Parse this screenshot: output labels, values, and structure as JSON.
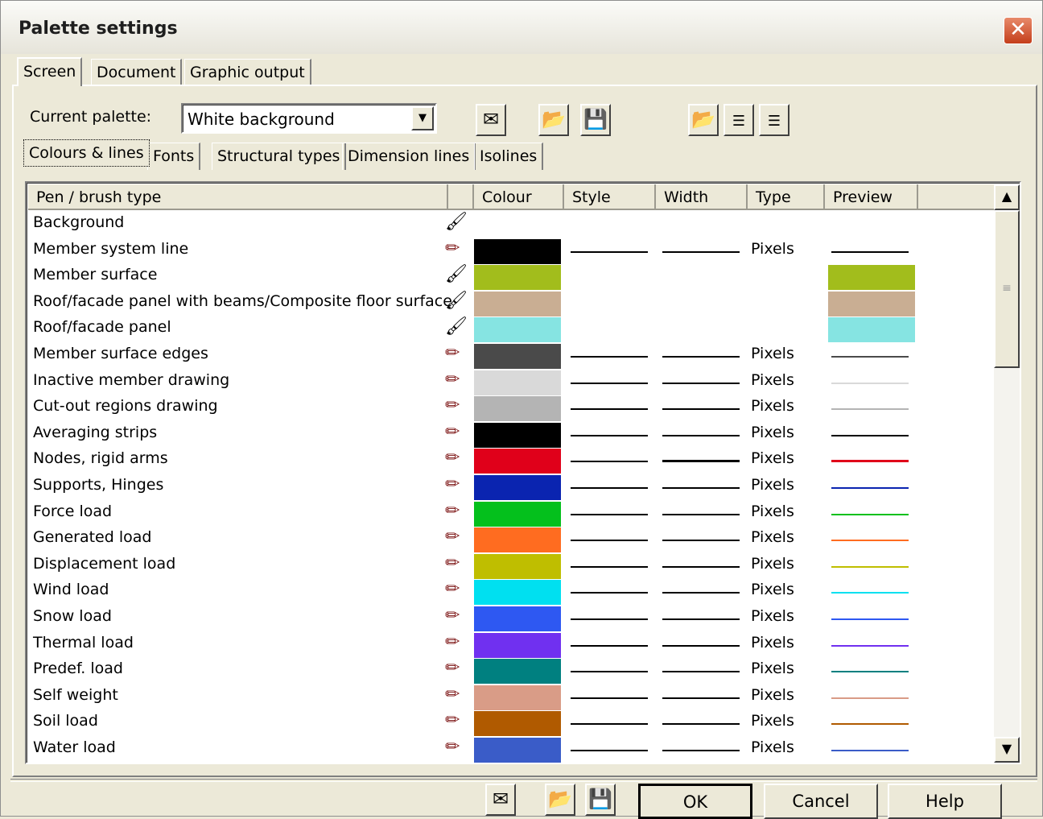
{
  "window": {
    "title": "Palette settings",
    "close": "✕"
  },
  "tabs": [
    "Screen",
    "Document",
    "Graphic output"
  ],
  "current_palette": {
    "label": "Current palette:",
    "value": "White background"
  },
  "subtabs": [
    "Colours & lines",
    "Fonts",
    "Structural types",
    "Dimension lines",
    "Isolines"
  ],
  "columns": [
    "Pen / brush type",
    "Colour",
    "Style",
    "Width",
    "Type",
    "Preview"
  ],
  "rows": [
    {
      "name": "Background",
      "kind": "brush",
      "color": "",
      "line": false,
      "type": "",
      "preview": ""
    },
    {
      "name": "Member system line",
      "kind": "pen",
      "color": "#000000",
      "line": true,
      "type": "Pixels",
      "preview": "#000000"
    },
    {
      "name": "Member surface",
      "kind": "brush",
      "color": "#A2BD1C",
      "line": false,
      "type": "",
      "preview": "#A2BD1C"
    },
    {
      "name": "Roof/facade panel with beams/Composite floor surface",
      "kind": "brush",
      "color": "#C9AE93",
      "line": false,
      "type": "",
      "preview": "#C9AE93"
    },
    {
      "name": "Roof/facade panel",
      "kind": "brush",
      "color": "#86E4E2",
      "line": false,
      "type": "",
      "preview": "#86E4E2"
    },
    {
      "name": "Member surface edges",
      "kind": "pen",
      "color": "#4A4A4A",
      "line": true,
      "type": "Pixels",
      "preview": "#4A4A4A"
    },
    {
      "name": "Inactive member drawing",
      "kind": "pen",
      "color": "#D9D9D9",
      "line": true,
      "type": "Pixels",
      "preview": "#D9D9D9"
    },
    {
      "name": "Cut-out regions drawing",
      "kind": "pen",
      "color": "#B4B4B4",
      "line": true,
      "type": "Pixels",
      "preview": "#B4B4B4"
    },
    {
      "name": "Averaging strips",
      "kind": "pen",
      "color": "#000000",
      "line": true,
      "type": "Pixels",
      "preview": "#000000"
    },
    {
      "name": "Nodes, rigid arms",
      "kind": "pen",
      "color": "#E0001A",
      "line": true,
      "type": "Pixels",
      "preview": "#E0001A",
      "bold": true
    },
    {
      "name": "Supports, Hinges",
      "kind": "pen",
      "color": "#0A24B0",
      "line": true,
      "type": "Pixels",
      "preview": "#0A24B0"
    },
    {
      "name": "Force load",
      "kind": "pen",
      "color": "#04C01C",
      "line": true,
      "type": "Pixels",
      "preview": "#04C01C"
    },
    {
      "name": "Generated load",
      "kind": "pen",
      "color": "#FF6C20",
      "line": true,
      "type": "Pixels",
      "preview": "#FF6C20"
    },
    {
      "name": "Displacement load",
      "kind": "pen",
      "color": "#BFBE00",
      "line": true,
      "type": "Pixels",
      "preview": "#BFBE00"
    },
    {
      "name": "Wind load",
      "kind": "pen",
      "color": "#00E0F0",
      "line": true,
      "type": "Pixels",
      "preview": "#00E0F0"
    },
    {
      "name": "Snow load",
      "kind": "pen",
      "color": "#2E58F2",
      "line": true,
      "type": "Pixels",
      "preview": "#2E58F2"
    },
    {
      "name": "Thermal load",
      "kind": "pen",
      "color": "#7030F0",
      "line": true,
      "type": "Pixels",
      "preview": "#7030F0"
    },
    {
      "name": "Predef. load",
      "kind": "pen",
      "color": "#008080",
      "line": true,
      "type": "Pixels",
      "preview": "#008080"
    },
    {
      "name": "Self weight",
      "kind": "pen",
      "color": "#D99C87",
      "line": true,
      "type": "Pixels",
      "preview": "#D99C87"
    },
    {
      "name": "Soil load",
      "kind": "pen",
      "color": "#B05A00",
      "line": true,
      "type": "Pixels",
      "preview": "#B05A00"
    },
    {
      "name": "Water load",
      "kind": "pen",
      "color": "#3A5CC8",
      "line": true,
      "type": "Pixels",
      "preview": "#3A5CC8"
    }
  ],
  "buttons": {
    "ok": "OK",
    "cancel": "Cancel",
    "help": "Help"
  }
}
